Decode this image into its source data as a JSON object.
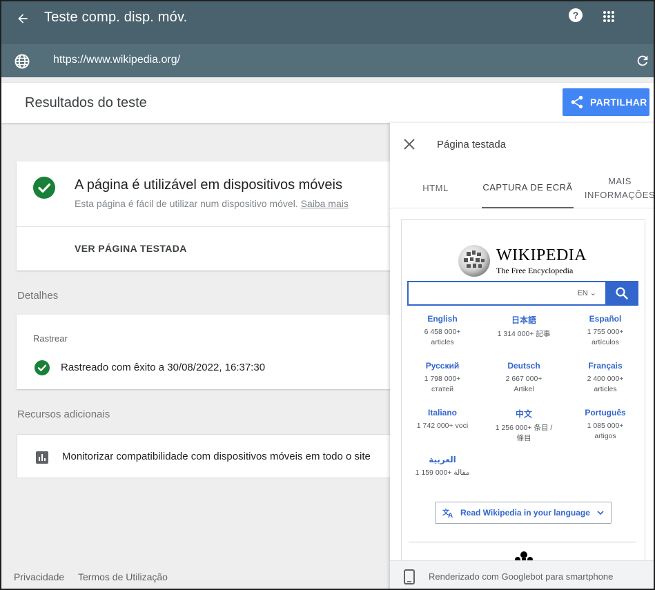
{
  "app": {
    "title": "Teste comp. disp. móv.",
    "url": "https://www.wikipedia.org/"
  },
  "results": {
    "title": "Resultados do teste",
    "share_label": "PARTILHAR"
  },
  "status_card": {
    "heading": "A página é utilizável em dispositivos móveis",
    "subtext": "Esta página é fácil de utilizar num dispositivo móvel.",
    "learn_more": "Saiba mais",
    "view_tested": "VER PÁGINA TESTADA"
  },
  "details": {
    "label": "Detalhes",
    "crawl_title": "Rastrear",
    "crawl_status": "Rastreado com êxito a 30/08/2022, 16:37:30"
  },
  "resources": {
    "label": "Recursos adicionais",
    "monitor": "Monitorizar compatibilidade com dispositivos móveis em todo o site"
  },
  "footer": {
    "privacy": "Privacidade",
    "terms": "Termos de Utilização"
  },
  "panel": {
    "title": "Página testada",
    "tabs": [
      {
        "label": "HTML"
      },
      {
        "label": "CAPTURA DE ECRÃ"
      },
      {
        "label": "MAIS INFORMAÇÕES"
      }
    ],
    "footer_note": "Renderizado com Googlebot para smartphone"
  },
  "wikipedia": {
    "name": "WIKIPEDIA",
    "tagline": "The Free Encyclopedia",
    "lang_selector": "EN",
    "languages": [
      {
        "name": "English",
        "count": "6 458 000+",
        "unit": "articles"
      },
      {
        "name": "日本語",
        "count": "1 314 000+ 記事",
        "unit": ""
      },
      {
        "name": "Español",
        "count": "1 755 000+",
        "unit": "artículos"
      },
      {
        "name": "Русский",
        "count": "1 798 000+",
        "unit": "статей"
      },
      {
        "name": "Deutsch",
        "count": "2 667 000+",
        "unit": "Artikel"
      },
      {
        "name": "Français",
        "count": "2 400 000+",
        "unit": "articles"
      },
      {
        "name": "Italiano",
        "count": "1 742 000+ voci",
        "unit": ""
      },
      {
        "name": "中文",
        "count": "1 256 000+ 条目 /",
        "unit": "條目"
      },
      {
        "name": "Português",
        "count": "1 085 000+",
        "unit": "artigos"
      },
      {
        "name": "العربية",
        "count": "1 159 000+ مقالة",
        "unit": ""
      }
    ],
    "read_button": "Read Wikipedia in your language"
  },
  "colors": {
    "appbar": "#546e7a",
    "appbar_top": "#4a626d",
    "accent": "#4285f4",
    "success": "#188038",
    "wiki_blue": "#3366cc"
  },
  "icons": {
    "back": "arrow-back-icon",
    "help": "help-circle-icon",
    "apps": "apps-grid-icon",
    "globe": "globe-icon",
    "reload": "reload-icon",
    "share": "share-icon",
    "check": "check-circle-icon",
    "chart": "bar-chart-icon",
    "close": "close-icon",
    "phone": "smartphone-icon"
  }
}
